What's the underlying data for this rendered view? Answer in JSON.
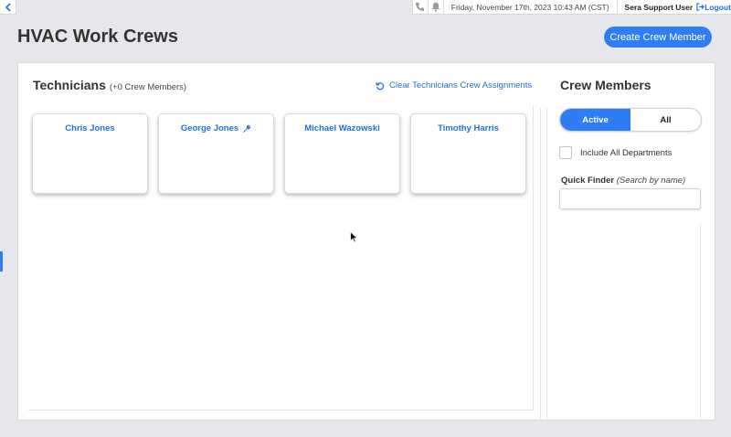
{
  "topbar": {
    "back_icon": "chevron-left-icon",
    "phone_icon": "phone-icon",
    "bell_icon": "bell-icon",
    "datetime": "Friday, November 17th, 2023 10:43 AM (CST)",
    "user": "Sera Support User",
    "logout_label": "Logout",
    "logout_icon": "logout-icon"
  },
  "page": {
    "title": "HVAC Work Crews",
    "create_button_label": "Create Crew Member"
  },
  "technicians": {
    "title": "Technicians",
    "count_label": "(+0 Crew Members)",
    "clear_label": "Clear Technicians Crew Assignments",
    "clear_icon": "undo-icon",
    "cards": [
      {
        "name": "Chris Jones",
        "icon": null
      },
      {
        "name": "George Jones",
        "icon": "wrench-icon"
      },
      {
        "name": "Michael Wazowski",
        "icon": null
      },
      {
        "name": "Timothy Harris",
        "icon": null
      }
    ]
  },
  "crew_members": {
    "title": "Crew Members",
    "toggle_options": [
      "Active",
      "All"
    ],
    "active_option": "Active",
    "include_all_label": "Include All Departments",
    "include_all_checked": false,
    "quick_finder_label": "Quick Finder",
    "quick_finder_hint": "(Search by name)",
    "quick_finder_value": ""
  },
  "colors": {
    "accent": "#2f7df6",
    "link": "#1f6fe0",
    "background": "#e6e7ea"
  }
}
